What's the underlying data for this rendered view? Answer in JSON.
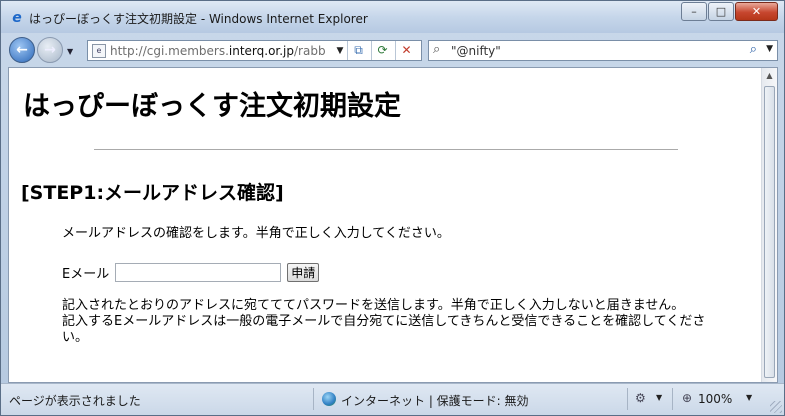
{
  "window": {
    "title": "はっぴーぼっくす注文初期設定 - Windows Internet Explorer",
    "minimize_glyph": "–",
    "maximize_glyph": "□",
    "close_glyph": "✕"
  },
  "nav": {
    "back_glyph": "←",
    "forward_glyph": "→",
    "address": {
      "prefix": "http://cgi.members.",
      "domain": "interq.or.jp",
      "suffix": "/rabb"
    },
    "search_text": "\"@nifty\""
  },
  "page": {
    "heading": "はっぴーぼっくす注文初期設定",
    "step_heading": "[STEP1:メールアドレス確認]",
    "intro": "メールアドレスの確認をします。半角で正しく入力してください。",
    "email_label": "Eメール",
    "email_value": "",
    "apply_label": "申請",
    "note_line1": "記入されたとおりのアドレスに宛てててパスワードを送信します。半角で正しく入力しないと届きません。",
    "note_line2": "記入するEメールアドレスは一般の電子メールで自分宛てに送信してきちんと受信できることを確認してください。"
  },
  "status": {
    "text": "ページが表示されました",
    "zone": "インターネット | 保護モード: 無効",
    "zoom": "100%"
  },
  "colors": {
    "frame": "#c6d6ea",
    "close_button": "#c7472f",
    "text": "#000000"
  }
}
